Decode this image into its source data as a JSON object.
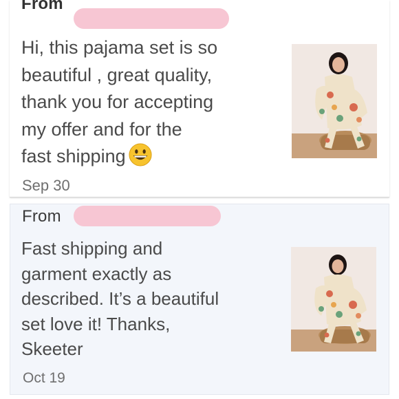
{
  "reviews": [
    {
      "from_label": "From",
      "message": "Hi, this pajama set is so\nbeautiful , great quality,\nthank you for accepting\nmy offer and for the\nfast shipping",
      "emoji": "grinning-face-emoji",
      "date": "Sep 30",
      "image": "model-in-floral-pajama-set"
    },
    {
      "from_label": "From",
      "message": "Fast shipping and\ngarment exactly as\ndescribed. It’s a beautiful\nset love it! Thanks,\nSkeeter",
      "date": "Oct 19",
      "image": "model-in-floral-pajama-set"
    }
  ],
  "colors": {
    "redaction": "#f7c6d3",
    "text": "#4a4a4a",
    "date": "#6f6f6f",
    "card2_bg": "#f3f6fb"
  }
}
